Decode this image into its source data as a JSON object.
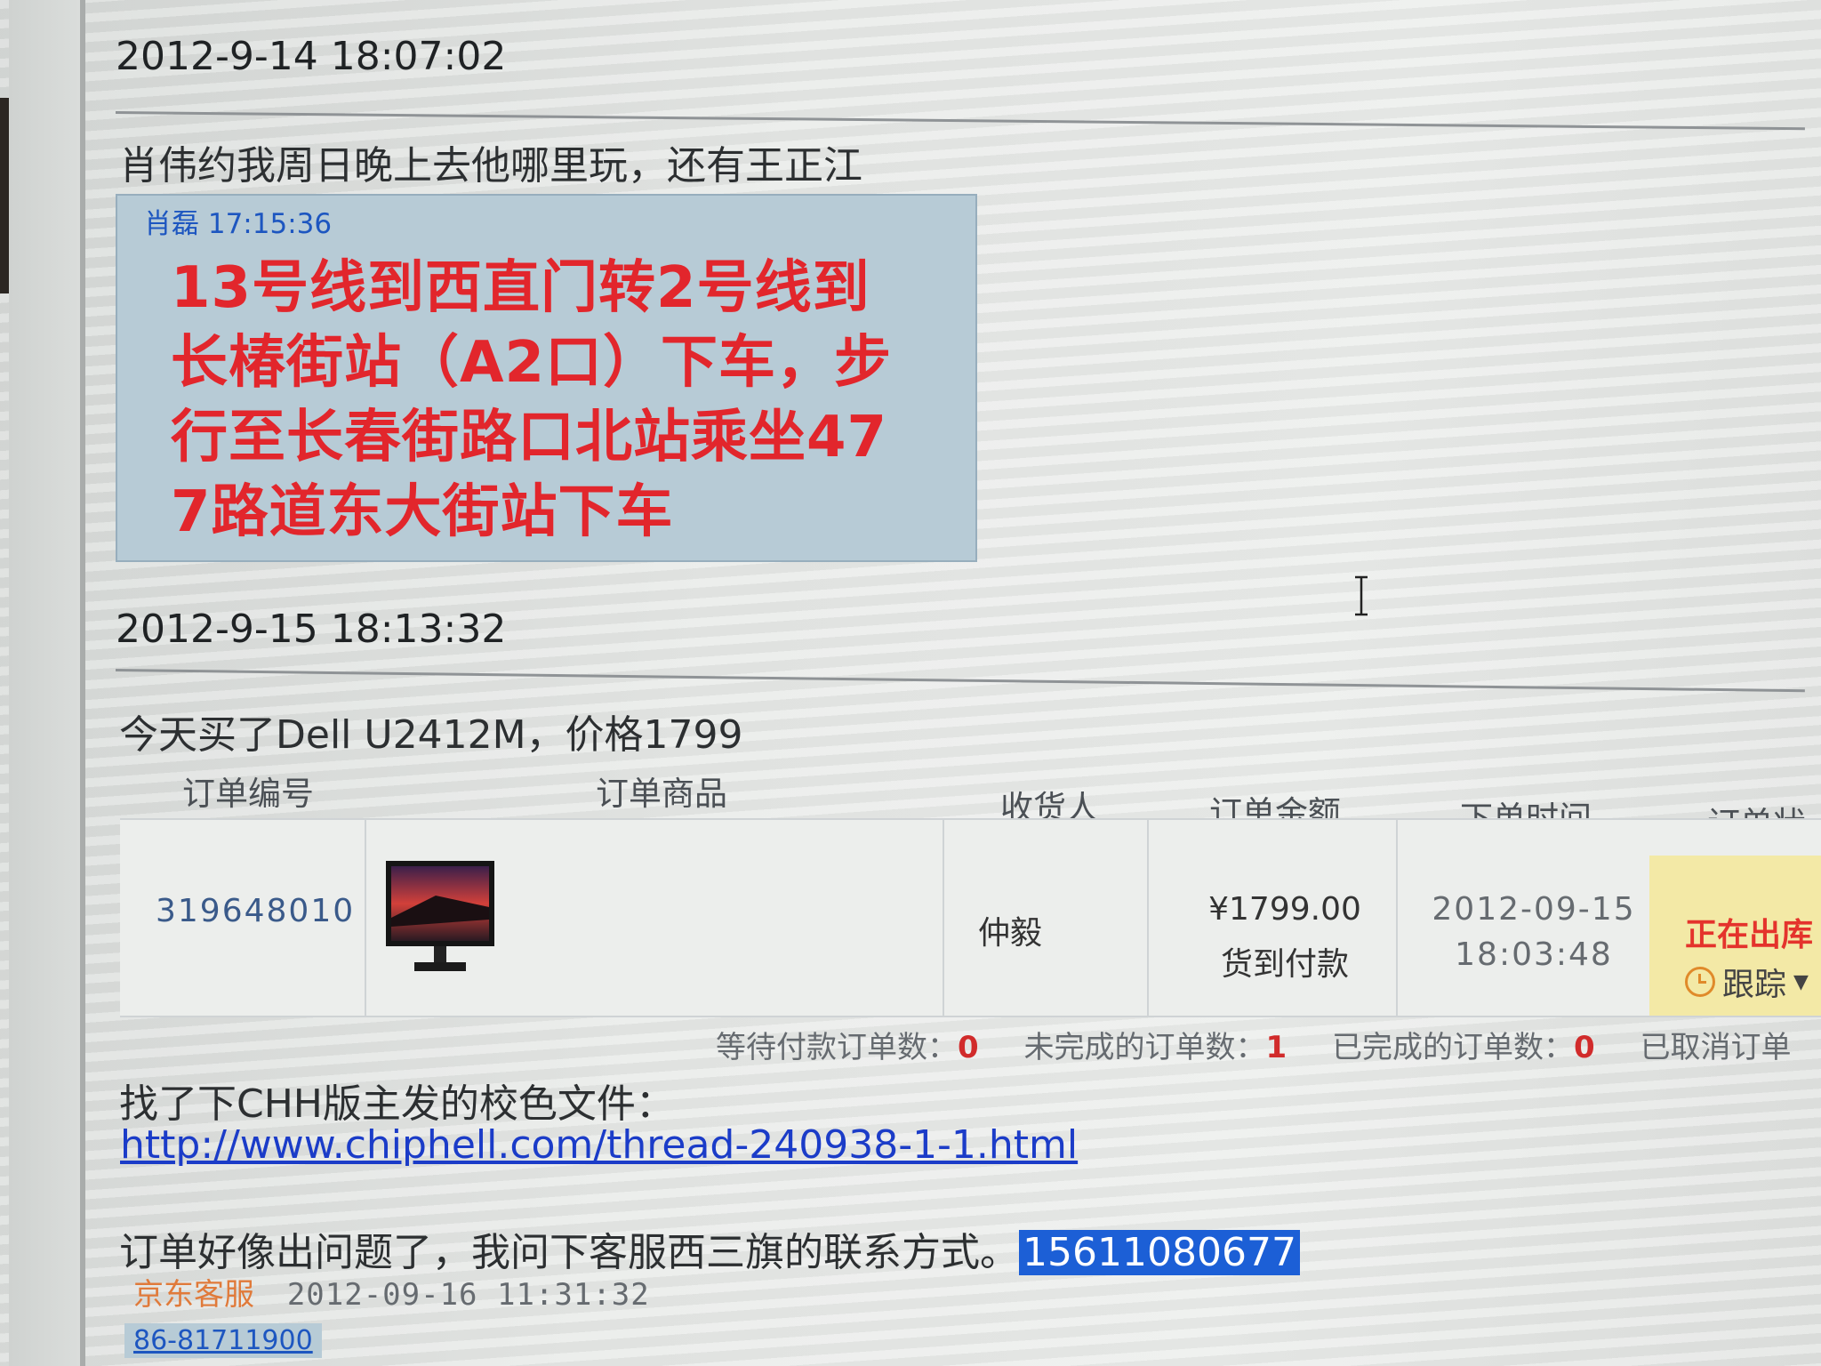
{
  "entries": [
    {
      "timestamp": "2012-9-14 18:07:02",
      "message": "肖伟约我周日晚上去他哪里玩，还有王正江",
      "quote": {
        "author": "肖磊",
        "time": "17:15:36",
        "lines": [
          "13号线到西直门转2号线到",
          "长椿街站（A2口）下车，步",
          "行至长春街路口北站乘坐47",
          "7路道东大街站下车"
        ]
      }
    },
    {
      "timestamp": "2012-9-15 18:13:32",
      "message": "今天买了Dell U2412M，价格1799"
    }
  ],
  "order_table": {
    "headers": [
      "订单编号",
      "订单商品",
      "收货人",
      "订单金额",
      "下单时间",
      "订单状态"
    ],
    "row": {
      "order_id": "319648010",
      "product_icon": "monitor-thumbnail",
      "receiver": "仲毅",
      "amount": "¥1799.00",
      "payment": "货到付款",
      "date": "2012-09-15",
      "time": "18:03:48",
      "status": "正在出库",
      "track_label": "跟踪"
    },
    "counts": [
      {
        "label": "等待付款订单数：",
        "value": "0"
      },
      {
        "label": "未完成的订单数：",
        "value": "1"
      },
      {
        "label": "已完成的订单数：",
        "value": "0"
      },
      {
        "label": "已取消订单",
        "value": ""
      }
    ]
  },
  "followups": {
    "line1": "找了下CHH版主发的校色文件：",
    "link": "http://www.chiphell.com/thread-240938-1-1.html",
    "line2": "订单好像出问题了，我问下客服西三旗的联系方式。",
    "highlight": "15611080677",
    "service_name": "京东客服",
    "service_time": "2012-09-16 11:31:32",
    "service_tag": "86-81711900"
  },
  "colors": {
    "quote_bg": "#b7cbd6",
    "quote_text": "#e2262c",
    "link": "#1b3cc8",
    "highlight_bg": "#1c5fd6",
    "status_bg": "#f3e9a6"
  }
}
